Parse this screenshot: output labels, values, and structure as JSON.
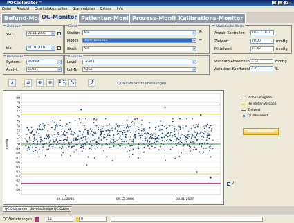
{
  "window": {
    "title": "POCcelerator™"
  },
  "menu": [
    "Datei",
    "Ansicht",
    "Qualitätskontrollen",
    "Stammdaten",
    "Extras",
    "Info"
  ],
  "tabs": [
    "Befund-Monitor",
    "QC-Monitor",
    "Patienten-Monitor",
    "Prozess-Monitor",
    "Kalibrations-Monitor"
  ],
  "zeitraum": {
    "title": "Zeitraum",
    "von_label": "von:",
    "von_value": "01.11.2006",
    "bis_label": "bis:",
    "bis_value": "31.01.2007"
  },
  "geraet": {
    "title": "Gerät",
    "station_label": "Station",
    "station_value": "Alle",
    "modell_label": "Modell",
    "modell_value": "Bayer Lab1265",
    "geraet_label": "Gerät",
    "geraet_value": "Alle"
  },
  "statistik": {
    "title": "Statistische Werte",
    "anzahl_label": "Anzahl Kontrollen",
    "anzahl_value": "1833 / 1834",
    "zielwert_label": "Zielwert",
    "zielwert_value": "70.00",
    "zielwert_unit": "mmHg",
    "mittelwert_label": "Mittelwert",
    "mittelwert_value": "71.43",
    "mittelwert_unit": "mmHg",
    "stdabw_label": "Standard-Abweichung",
    "stdabw_value": "1.72",
    "stdabw_unit": "mmHg",
    "vk_label": "Variations-Koeffizient",
    "vk_value": "2.41",
    "vk_unit": "%"
  },
  "parameter": {
    "title": "Parameter",
    "system_label": "System:",
    "system_value": "Vollblut",
    "analyt_label": "Analyt:",
    "analyt_value": "pCO2"
  },
  "kontrolle": {
    "title": "Kontrolle",
    "level_label": "Level:",
    "level_value": "Level 1",
    "lot_label": "Lot-Nr:",
    "lot_value": "AQC1"
  },
  "toolbar": {
    "zoom_label": "1:1",
    "chart_heading": "Qualitätskontrollmessungen"
  },
  "legend": {
    "rilibak": "Rilibäk-Vorgabe",
    "hersteller": "Hersteller-Vorgabe",
    "zielwert": "Zielwert",
    "messwert": "QC-Messwert",
    "button": "Aktualisieren",
    "v_check": "V"
  },
  "chart_data": {
    "type": "scatter",
    "ylabel": "mmHg",
    "ylim": [
      59,
      81
    ],
    "yticks": [
      "80",
      "79",
      "78",
      "77",
      "76",
      "75",
      "74",
      "73",
      "72",
      "71",
      "70",
      "69",
      "68",
      "67",
      "66",
      "65",
      "64",
      "63",
      "62",
      "61",
      "60"
    ],
    "xticks": [
      "09.11.2006",
      "09.12.2006",
      "08.01.2007"
    ],
    "reference_lines": {
      "rilibak_upper": 78.5,
      "rilibak_lower": 61.5,
      "hersteller_upper": 76.5,
      "hersteller_lower": 63.5,
      "zielwert": 70.0
    },
    "points_center": 71.4,
    "points_spread": 1.72,
    "outliers": [
      78.0,
      77.5,
      76.3,
      63.9,
      62.7
    ]
  },
  "bottom_tabs": [
    "QC-Diagramm",
    "Unvollständige QC-Daten"
  ],
  "status": {
    "label": "QC-Verletzungen",
    "count_red": "12",
    "count_yellow": "9"
  },
  "colors": {
    "rilibak": "#b0307a",
    "hersteller": "#e8d040",
    "zielwert": "#3a9a3a",
    "messwert": "#1f4e78"
  }
}
